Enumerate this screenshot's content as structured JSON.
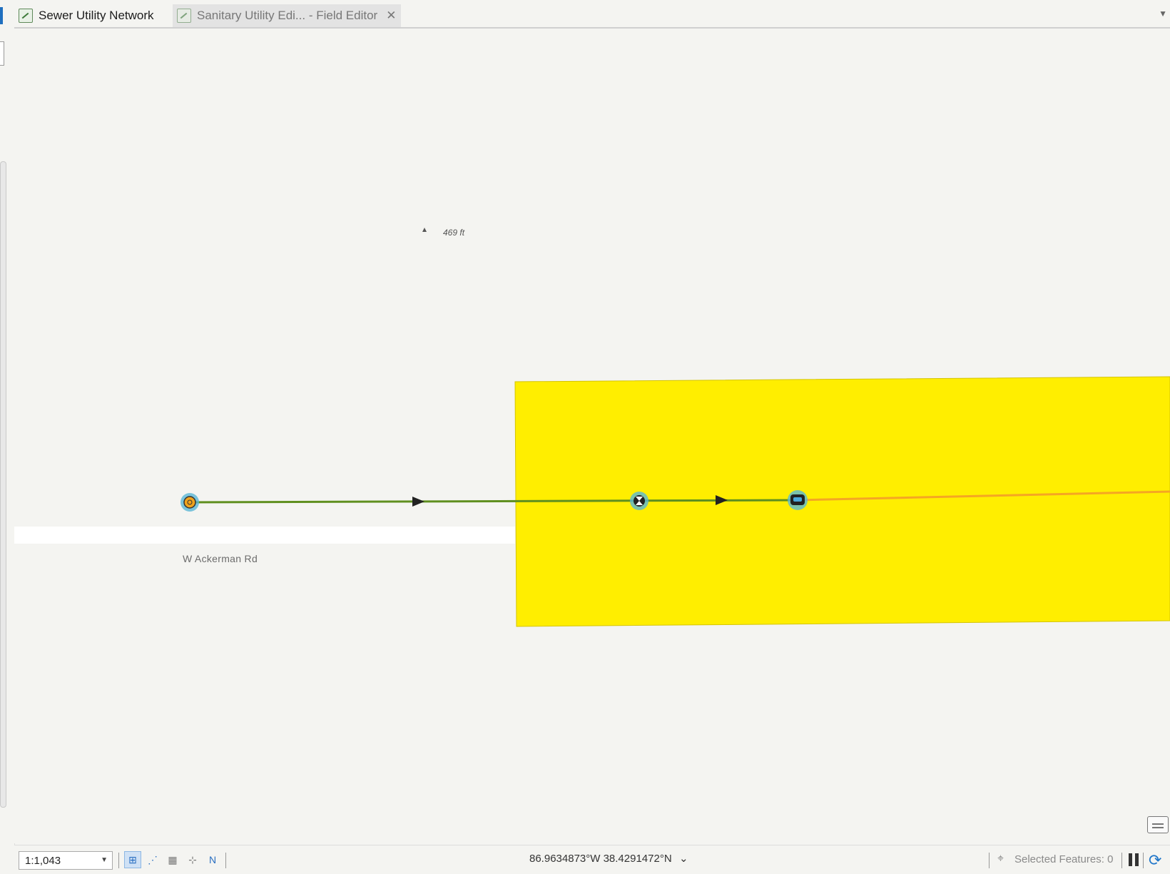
{
  "tabs": [
    {
      "label": "Sewer Utility Network",
      "active": true
    },
    {
      "label": "Sanitary Utility Edi... - Field Editor",
      "active": false
    }
  ],
  "map": {
    "road_label": "W Ackerman Rd",
    "dimension_label": "469 ft",
    "colors": {
      "background": "#f4f4f1",
      "parcel_fill": "#ffee00",
      "pipe_green": "#5f8f1f",
      "pipe_orange": "#f5a623",
      "node_halo": "#5ab7d6"
    },
    "icons": [
      "manhole-node-icon",
      "valve-node-icon",
      "structure-node-icon",
      "flow-direction-arrow-icon"
    ]
  },
  "status": {
    "scale": "1:1,043",
    "coordinates": "86.9634873°W 38.4291472°N",
    "selected_features": "Selected Features: 0"
  }
}
